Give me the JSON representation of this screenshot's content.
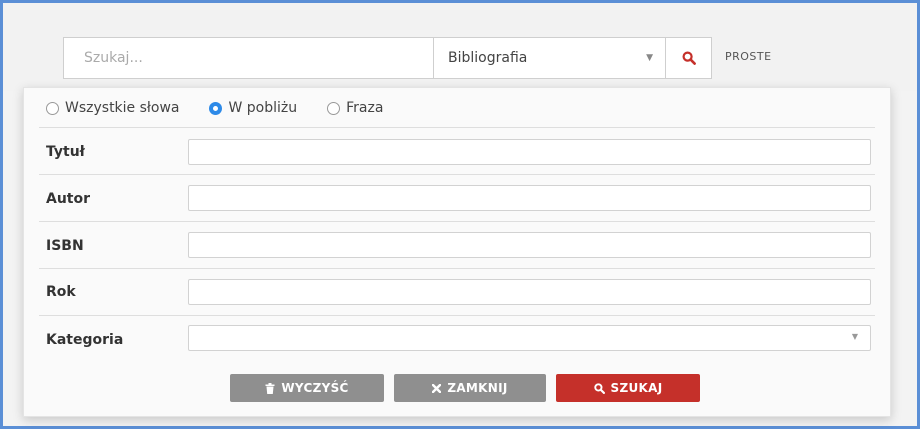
{
  "search": {
    "placeholder": "Szukaj...",
    "scope_selected": "Bibliografia",
    "mode_link": "PROSTE"
  },
  "advanced": {
    "match_modes": [
      {
        "label": "Wszystkie słowa",
        "checked": false
      },
      {
        "label": "W pobliżu",
        "checked": true
      },
      {
        "label": "Fraza",
        "checked": false
      }
    ],
    "fields": [
      {
        "label": "Tytuł",
        "value": ""
      },
      {
        "label": "Autor",
        "value": ""
      },
      {
        "label": "ISBN",
        "value": ""
      },
      {
        "label": "Rok",
        "value": ""
      },
      {
        "label": "Kategoria",
        "value": ""
      }
    ],
    "buttons": {
      "clear": "WYCZYŚĆ",
      "close": "ZAMKNIJ",
      "search": "SZUKAJ"
    }
  },
  "colors": {
    "accent_red": "#c5302a",
    "radio_blue": "#2d8ae8",
    "button_grey": "#8f8f8f",
    "frame_blue": "#5b8fd6"
  },
  "icons": {
    "search": "magnifier-icon",
    "clear": "trash-icon",
    "close": "x-icon",
    "dropdown": "caret-down-icon"
  }
}
